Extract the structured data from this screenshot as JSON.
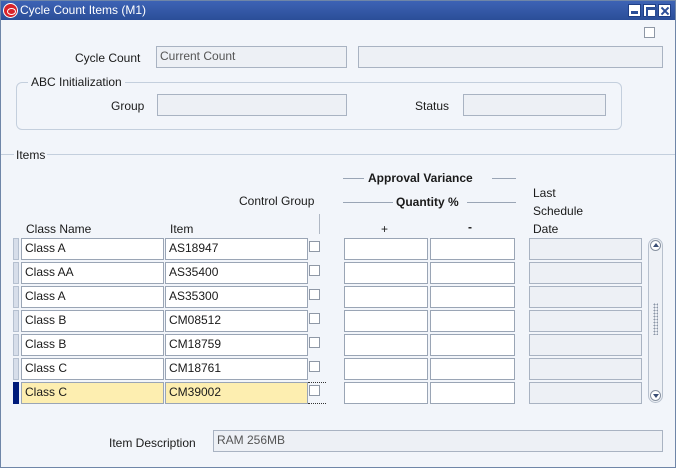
{
  "window": {
    "title": "Cycle Count Items (M1)"
  },
  "header": {
    "cycle_count_label": "Cycle Count",
    "cycle_count_value": "Current Count",
    "cycle_count_desc": ""
  },
  "abc": {
    "legend": "ABC Initialization",
    "group_label": "Group",
    "group_value": "",
    "status_label": "Status",
    "status_value": ""
  },
  "items": {
    "section_label": "Items",
    "columns": {
      "control_group": "Control Group",
      "approval_variance": "Approval Variance",
      "quantity_pct": "Quantity %",
      "plus": "+",
      "minus": "-",
      "last_schedule_1": "Last",
      "last_schedule_2": "Schedule",
      "last_schedule_3": "Date",
      "class_name": "Class Name",
      "item": "Item"
    },
    "rows": [
      {
        "class_name": "Class A",
        "item": "AS18947",
        "control_group": false,
        "plus": "",
        "minus": "",
        "last_schedule_date": ""
      },
      {
        "class_name": "Class AA",
        "item": "AS35400",
        "control_group": false,
        "plus": "",
        "minus": "",
        "last_schedule_date": ""
      },
      {
        "class_name": "Class A",
        "item": "AS35300",
        "control_group": false,
        "plus": "",
        "minus": "",
        "last_schedule_date": ""
      },
      {
        "class_name": "Class B",
        "item": "CM08512",
        "control_group": false,
        "plus": "",
        "minus": "",
        "last_schedule_date": ""
      },
      {
        "class_name": "Class B",
        "item": "CM18759",
        "control_group": false,
        "plus": "",
        "minus": "",
        "last_schedule_date": ""
      },
      {
        "class_name": "Class C",
        "item": "CM18761",
        "control_group": false,
        "plus": "",
        "minus": "",
        "last_schedule_date": ""
      },
      {
        "class_name": "Class C",
        "item": "CM39002",
        "control_group": false,
        "plus": "",
        "minus": "",
        "last_schedule_date": ""
      }
    ],
    "current_row": 7
  },
  "footer": {
    "item_desc_label": "Item Description",
    "item_desc_value": "RAM 256MB"
  },
  "colors": {
    "titlebar": "#2b4e98",
    "current_row_highlight": "#fdeeb0",
    "current_row_marker": "#001b7a"
  },
  "icons": [
    "oracle-logo-icon",
    "minimize-icon",
    "maximize-icon",
    "close-icon",
    "scroll-up-icon",
    "scroll-down-icon"
  ]
}
